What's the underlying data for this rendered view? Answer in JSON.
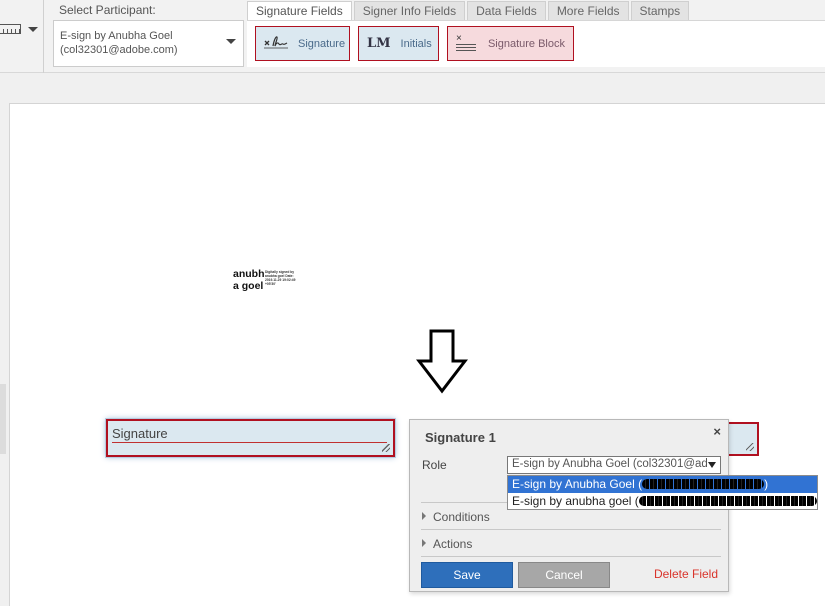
{
  "toolbar": {
    "participant_label": "Select Participant:",
    "participant_value": "E-sign by Anubha Goel (col32301@adobe.com)",
    "tabs": [
      "Signature Fields",
      "Signer Info Fields",
      "Data Fields",
      "More Fields",
      "Stamps"
    ],
    "active_tab": "Signature Fields",
    "fields": {
      "signature": {
        "label": "Signature",
        "icon": "x-signature-icon"
      },
      "initials": {
        "label": "Initials",
        "icon_text": "LM"
      },
      "signature_block": {
        "label": "Signature Block",
        "icon": "signature-block-icon"
      }
    }
  },
  "document": {
    "sample_signature": {
      "name_line1": "anubh",
      "name_line2": "a goel",
      "fine_print": "Digitally signed by anubha goel Date: 2019.11.29 19:02:49 +05'30'"
    },
    "signature_field_text": "Signature"
  },
  "popup": {
    "title": "Signature 1",
    "close": "×",
    "role_label": "Role",
    "role_value": "E-sign by Anubha Goel (col32301@ad",
    "role_options": [
      {
        "label": "E-sign by Anubha Goel (",
        "suffix": ")",
        "selected": true
      },
      {
        "label": "E-sign by anubha goel (",
        "suffix": ")",
        "selected": false
      }
    ],
    "conditions": "Conditions",
    "actions": "Actions",
    "save": "Save",
    "cancel": "Cancel",
    "delete": "Delete Field"
  },
  "colors": {
    "accent_red": "#b01020",
    "field_blue": "#dbe8f0",
    "save_blue": "#2e6fbb",
    "delete_red": "#d9342b"
  }
}
